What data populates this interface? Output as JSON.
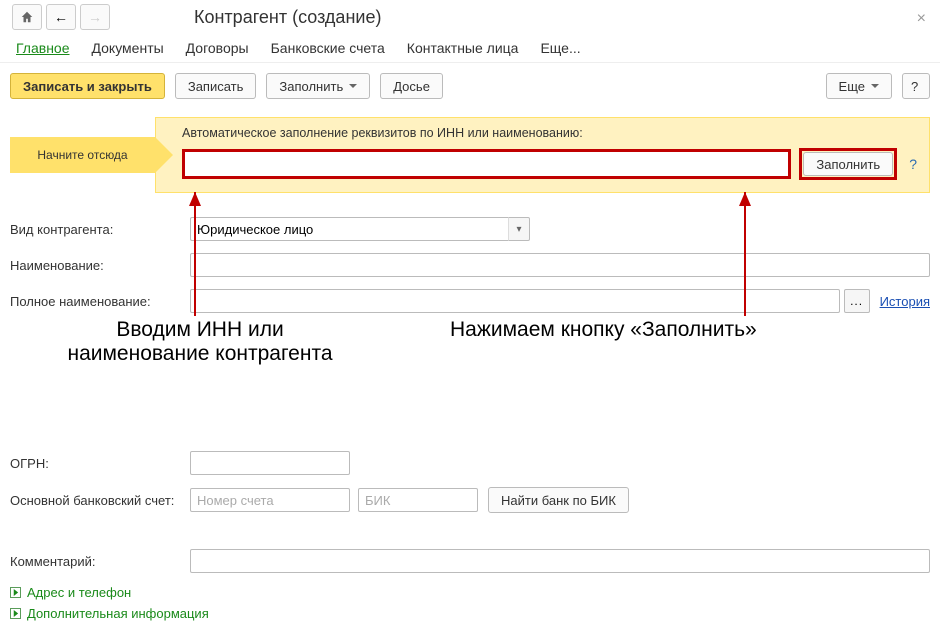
{
  "window": {
    "title": "Контрагент (создание)",
    "close": "×"
  },
  "tabs": {
    "t0": "Главное",
    "t1": "Документы",
    "t2": "Договоры",
    "t3": "Банковские счета",
    "t4": "Контактные лица",
    "t5": "Еще..."
  },
  "toolbar": {
    "saveclose": "Записать и закрыть",
    "save": "Записать",
    "fill": "Заполнить",
    "dossier": "Досье",
    "more": "Еще",
    "help": "?"
  },
  "autofill": {
    "start": "Начните отсюда",
    "label": "Автоматическое заполнение реквизитов по ИНН или наименованию:",
    "button": "Заполнить",
    "help": "?"
  },
  "form": {
    "kind_label": "Вид контрагента:",
    "kind_value": "Юридическое лицо",
    "name_label": "Наименование:",
    "fullname_label": "Полное наименование:",
    "history": "История",
    "ogrn_label": "ОГРН:",
    "bank_label": "Основной банковский счет:",
    "bank_account_ph": "Номер счета",
    "bank_bic_ph": "БИК",
    "bank_find": "Найти банк по БИК",
    "comment_label": "Комментарий:",
    "section_address": "Адрес и телефон",
    "section_extra": "Дополнительная информация"
  },
  "annotations": {
    "left": "Вводим ИНН или\nнаименование контрагента",
    "right": "Нажимаем кнопку «Заполнить»"
  }
}
